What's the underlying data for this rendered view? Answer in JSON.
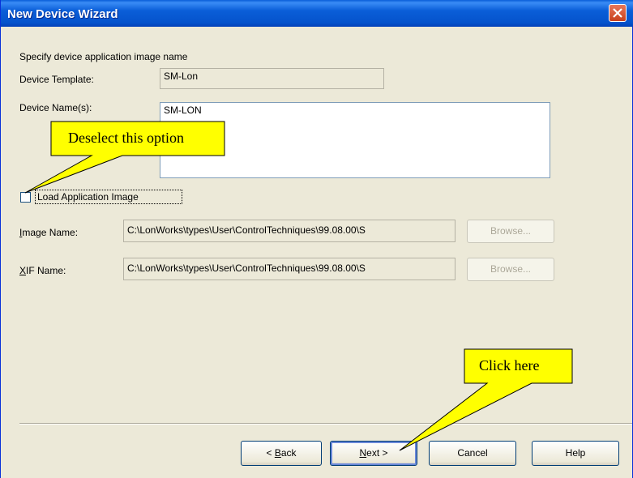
{
  "window": {
    "title": "New Device Wizard"
  },
  "form": {
    "heading": "Specify device application image name",
    "template_label": "Device Template:",
    "template_value": "SM-Lon",
    "names_label": "Device Name(s):",
    "names_value": "SM-LON",
    "load_checkbox_label": "Load Application Image",
    "load_checkbox_checked": false,
    "image_label": "Image Name:",
    "image_value": "C:\\LonWorks\\types\\User\\ControlTechniques\\99.08.00\\S",
    "image_browse": "Browse...",
    "xif_label": "XIF Name:",
    "xif_value": "C:\\LonWorks\\types\\User\\ControlTechniques\\99.08.00\\S",
    "xif_browse": "Browse..."
  },
  "buttons": {
    "back": "< Back",
    "next": "Next >",
    "cancel": "Cancel",
    "help": "Help"
  },
  "callouts": {
    "deselect": "Deselect this option",
    "click": "Click here",
    "color": "#ffff00"
  }
}
